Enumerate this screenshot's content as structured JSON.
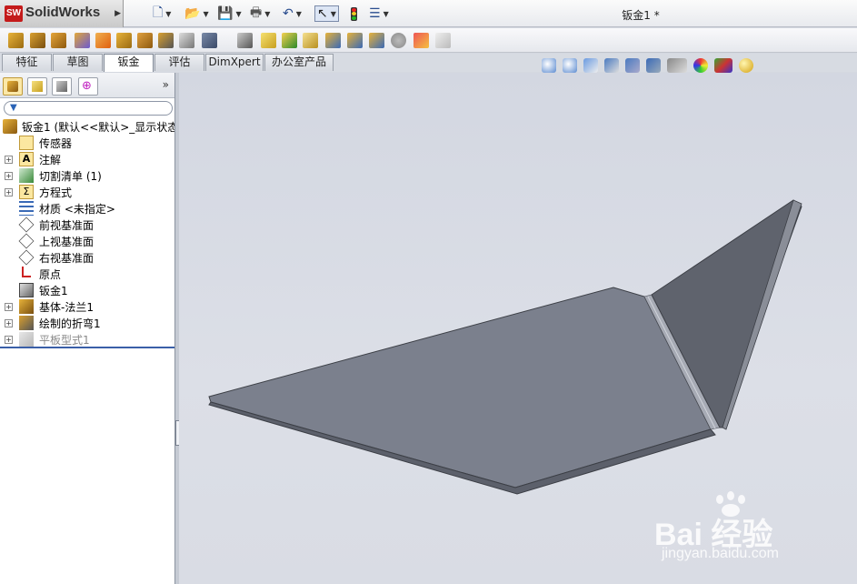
{
  "app": {
    "logo_text": "SolidWorks",
    "logo_badge": "SW",
    "document_title": "钣金1 *"
  },
  "tabs": [
    {
      "label": "特征"
    },
    {
      "label": "草图"
    },
    {
      "label": "钣金",
      "active": true
    },
    {
      "label": "评估"
    },
    {
      "label": "DimXpert"
    },
    {
      "label": "办公室产品"
    }
  ],
  "panel": {
    "collapse_glyph": "»",
    "filter_placeholder": ""
  },
  "tree": [
    {
      "label": "钣金1   (默认<<默认>_显示状态",
      "icon": "part-icon",
      "expandable": false,
      "root": true
    },
    {
      "label": "传感器",
      "icon": "sensor-icon",
      "expandable": false
    },
    {
      "label": "注解",
      "icon": "annotation-icon",
      "expandable": true
    },
    {
      "label": "切割清单 (1)",
      "icon": "cut-list-icon",
      "expandable": true
    },
    {
      "label": "方程式",
      "icon": "equation-icon",
      "expandable": true
    },
    {
      "label": "材质 <未指定>",
      "icon": "material-icon",
      "expandable": false
    },
    {
      "label": "前视基准面",
      "icon": "plane-icon",
      "expandable": false
    },
    {
      "label": "上视基准面",
      "icon": "plane-icon",
      "expandable": false
    },
    {
      "label": "右视基准面",
      "icon": "plane-icon",
      "expandable": false
    },
    {
      "label": "原点",
      "icon": "origin-icon",
      "expandable": false
    },
    {
      "label": "钣金1",
      "icon": "sheet-metal-icon",
      "expandable": false
    },
    {
      "label": "基体-法兰1",
      "icon": "base-flange-icon",
      "expandable": true
    },
    {
      "label": "绘制的折弯1",
      "icon": "sketched-bend-icon",
      "expandable": true
    },
    {
      "label": "平板型式1",
      "icon": "flat-pattern-icon",
      "expandable": true,
      "suppressed": true
    }
  ],
  "watermark": {
    "brand": "Bai 经验",
    "url": "jingyan.baidu.com"
  },
  "colors": {
    "accent": "#3a5fa8",
    "model_top": "#7a7f8c",
    "model_side": "#5a5e69",
    "viewport_bg": "#d6d9e1"
  }
}
